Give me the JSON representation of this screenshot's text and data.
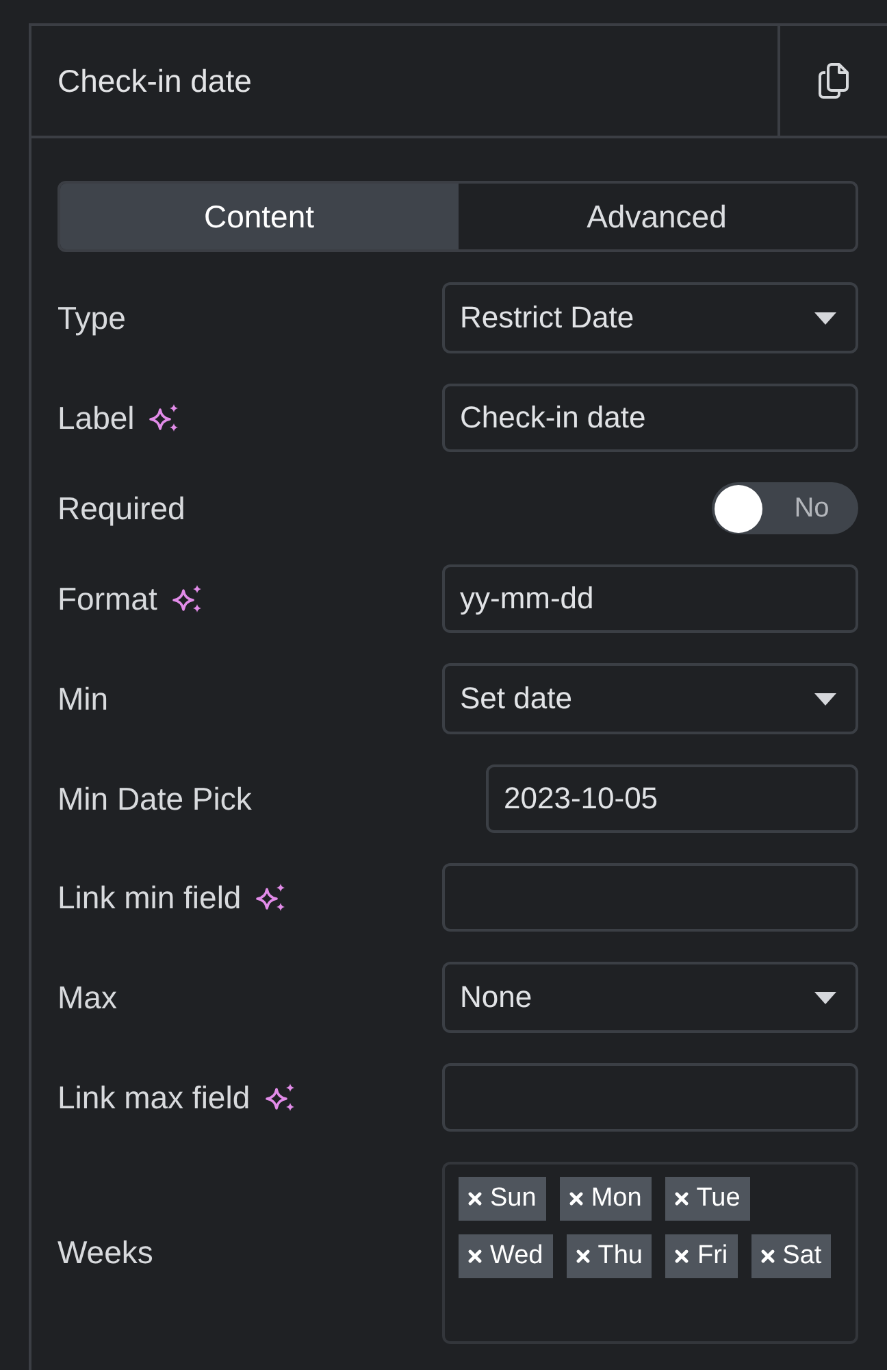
{
  "panel": {
    "title": "Check-in date"
  },
  "tabs": [
    {
      "label": "Content",
      "selected": true
    },
    {
      "label": "Advanced",
      "selected": false
    }
  ],
  "fields": [
    {
      "kind": "select",
      "label": "Type",
      "sparkle": false,
      "value": "Restrict Date"
    },
    {
      "kind": "text",
      "label": "Label",
      "sparkle": true,
      "value": "Check-in date"
    },
    {
      "kind": "toggle",
      "label": "Required",
      "sparkle": false,
      "on": false,
      "state_text": "No"
    },
    {
      "kind": "text",
      "label": "Format",
      "sparkle": true,
      "value": "yy-mm-dd"
    },
    {
      "kind": "select",
      "label": "Min",
      "sparkle": false,
      "value": "Set date"
    },
    {
      "kind": "date",
      "label": "Min Date Pick",
      "sparkle": false,
      "value": "2023-10-05"
    },
    {
      "kind": "text",
      "label": "Link min field",
      "sparkle": true
    },
    {
      "kind": "select",
      "label": "Max",
      "sparkle": false,
      "value": "None"
    },
    {
      "kind": "text",
      "label": "Link max field",
      "sparkle": true
    },
    {
      "kind": "tags",
      "label": "Weeks",
      "sparkle": false,
      "tags": [
        "Sun",
        "Mon",
        "Tue",
        "Wed",
        "Thu",
        "Fri",
        "Sat"
      ]
    }
  ]
}
